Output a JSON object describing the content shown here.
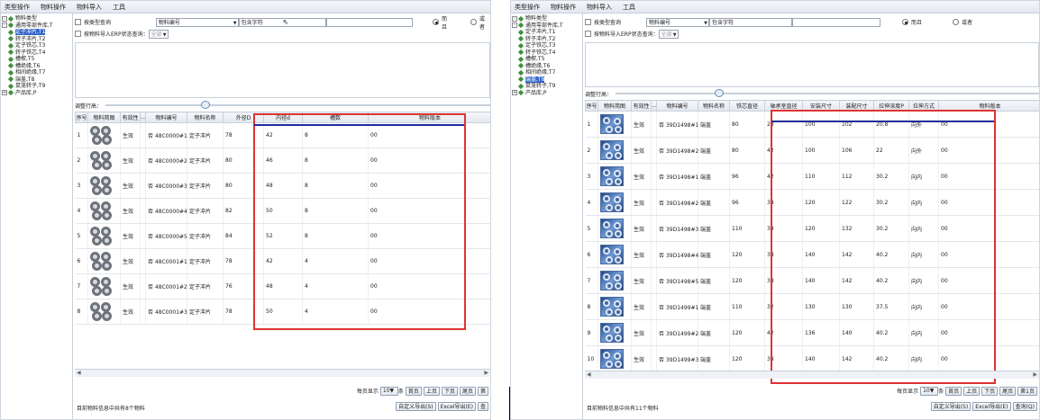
{
  "menu": [
    "类型操作",
    "物料操作",
    "物料导入",
    "工具"
  ],
  "tree_panel_a": [
    {
      "label": "物料类型",
      "level": 0,
      "expander": "-"
    },
    {
      "label": "通用零部件库,T",
      "level": 0,
      "expander": "-"
    },
    {
      "label": "定子冲片,T1",
      "level": 1,
      "selected": true
    },
    {
      "label": "转子冲片,T2",
      "level": 1
    },
    {
      "label": "定子铁芯,T3",
      "level": 1
    },
    {
      "label": "转子铁芯,T4",
      "level": 1
    },
    {
      "label": "槽楔,T5",
      "level": 1
    },
    {
      "label": "槽绝缘,T6",
      "level": 1
    },
    {
      "label": "相间绝缘,T7",
      "level": 1
    },
    {
      "label": "端盖,T8",
      "level": 1
    },
    {
      "label": "鼠笼转子,T9",
      "level": 1
    },
    {
      "label": "产品库,P",
      "level": 0,
      "expander": "+"
    }
  ],
  "tree_panel_b": [
    {
      "label": "物料类型",
      "level": 0,
      "expander": "-"
    },
    {
      "label": "通用零部件库,T",
      "level": 0,
      "expander": "-"
    },
    {
      "label": "定子冲片,T1",
      "level": 1
    },
    {
      "label": "转子冲片,T2",
      "level": 1
    },
    {
      "label": "定子铁芯,T3",
      "level": 1
    },
    {
      "label": "转子铁芯,T4",
      "level": 1
    },
    {
      "label": "槽楔,T5",
      "level": 1
    },
    {
      "label": "槽绝缘,T6",
      "level": 1
    },
    {
      "label": "相间绝缘,T7",
      "level": 1
    },
    {
      "label": "端盖,T8",
      "level": 1,
      "selected": true
    },
    {
      "label": "鼠笼转子,T9",
      "level": 1
    },
    {
      "label": "产品库,P",
      "level": 0,
      "expander": "+"
    }
  ],
  "filter": {
    "by_type_label": "按类型查询",
    "field": "物料编号",
    "op": "包含字符",
    "value": "",
    "and_label": "而且",
    "or_label": "或者",
    "erp_label": "按物料导入ERP状态查询：",
    "erp_value": "全部"
  },
  "adjust_label": "调整行高：",
  "panel_a": {
    "columns": [
      "序号",
      "物料简图",
      "有效性",
      "...",
      "物料编号",
      "物料名称",
      "外径D",
      "内径d",
      "槽数",
      "物料版本"
    ],
    "rows": [
      {
        "no": "1",
        "valid": "生效",
        "dots": "否",
        "code": "48C0000#1",
        "name": "定子冲片",
        "D": "78",
        "d": "42",
        "slots": "8",
        "ver": "00"
      },
      {
        "no": "2",
        "valid": "生效",
        "dots": "否",
        "code": "48C0000#2",
        "name": "定子冲片",
        "D": "80",
        "d": "46",
        "slots": "8",
        "ver": "00"
      },
      {
        "no": "3",
        "valid": "生效",
        "dots": "否",
        "code": "48C0000#3",
        "name": "定子冲片",
        "D": "80",
        "d": "48",
        "slots": "8",
        "ver": "00"
      },
      {
        "no": "4",
        "valid": "生效",
        "dots": "否",
        "code": "48C0000#4",
        "name": "定子冲片",
        "D": "82",
        "d": "50",
        "slots": "8",
        "ver": "00"
      },
      {
        "no": "5",
        "valid": "生效",
        "dots": "否",
        "code": "48C0000#5",
        "name": "定子冲片",
        "D": "84",
        "d": "52",
        "slots": "8",
        "ver": "00"
      },
      {
        "no": "6",
        "valid": "生效",
        "dots": "否",
        "code": "48C0001#1",
        "name": "定子冲片",
        "D": "78",
        "d": "42",
        "slots": "4",
        "ver": "00"
      },
      {
        "no": "7",
        "valid": "生效",
        "dots": "否",
        "code": "48C0001#2",
        "name": "定子冲片",
        "D": "76",
        "d": "48",
        "slots": "4",
        "ver": "00"
      },
      {
        "no": "8",
        "valid": "生效",
        "dots": "否",
        "code": "48C0001#3",
        "name": "定子冲片",
        "D": "78",
        "d": "50",
        "slots": "4",
        "ver": "00"
      }
    ],
    "page_size_label": "每页显示",
    "page_size": "10",
    "page_size_unit": "条",
    "pager_buttons": [
      "首页",
      "上页",
      "下页",
      "尾页",
      "第"
    ],
    "status": "目前物料信息中共有8个物料",
    "export_buttons": [
      "自定义导出(S)",
      "Excel导出(E)",
      "查"
    ]
  },
  "panel_b": {
    "columns": [
      "序号",
      "物料简图",
      "有效性",
      "...",
      "物料编号",
      "物料名称",
      "铁芯直径",
      "轴承室直径",
      "安装尺寸",
      "装配尺寸",
      "拉伸深度P",
      "拉伸方式",
      "物料版本"
    ],
    "rows": [
      {
        "no": "1",
        "valid": "生效",
        "dots": "否",
        "code": "39D1498#1",
        "name": "端盖",
        "c1": "80",
        "c2": "28",
        "c3": "100",
        "c4": "102",
        "c5": "20.8",
        "c6": "向外",
        "ver": "00"
      },
      {
        "no": "2",
        "valid": "生效",
        "dots": "否",
        "code": "39D1498#2",
        "name": "端盖",
        "c1": "80",
        "c2": "42",
        "c3": "100",
        "c4": "106",
        "c5": "22",
        "c6": "向外",
        "ver": "00"
      },
      {
        "no": "3",
        "valid": "生效",
        "dots": "否",
        "code": "39D1498#1",
        "name": "端盖",
        "c1": "96",
        "c2": "42",
        "c3": "110",
        "c4": "112",
        "c5": "30.2",
        "c6": "向内",
        "ver": "00"
      },
      {
        "no": "4",
        "valid": "生效",
        "dots": "否",
        "code": "39D1498#2",
        "name": "端盖",
        "c1": "96",
        "c2": "38",
        "c3": "120",
        "c4": "122",
        "c5": "30.2",
        "c6": "向内",
        "ver": "00"
      },
      {
        "no": "5",
        "valid": "生效",
        "dots": "否",
        "code": "39D1498#3",
        "name": "端盖",
        "c1": "110",
        "c2": "38",
        "c3": "120",
        "c4": "132",
        "c5": "30.2",
        "c6": "向内",
        "ver": "00"
      },
      {
        "no": "6",
        "valid": "生效",
        "dots": "否",
        "code": "39D1498#4",
        "name": "端盖",
        "c1": "120",
        "c2": "38",
        "c3": "140",
        "c4": "142",
        "c5": "40.2",
        "c6": "向内",
        "ver": "00"
      },
      {
        "no": "7",
        "valid": "生效",
        "dots": "否",
        "code": "39D1498#5",
        "name": "端盖",
        "c1": "120",
        "c2": "38",
        "c3": "140",
        "c4": "142",
        "c5": "40.2",
        "c6": "向内",
        "ver": "00"
      },
      {
        "no": "8",
        "valid": "生效",
        "dots": "否",
        "code": "39D1499#1",
        "name": "端盖",
        "c1": "110",
        "c2": "32",
        "c3": "130",
        "c4": "130",
        "c5": "37.5",
        "c6": "向内",
        "ver": "00"
      },
      {
        "no": "9",
        "valid": "生效",
        "dots": "否",
        "code": "39D1499#2",
        "name": "端盖",
        "c1": "120",
        "c2": "42",
        "c3": "136",
        "c4": "140",
        "c5": "40.2",
        "c6": "向内",
        "ver": "00"
      },
      {
        "no": "10",
        "valid": "生效",
        "dots": "否",
        "code": "39D1499#3",
        "name": "端盖",
        "c1": "120",
        "c2": "38",
        "c3": "140",
        "c4": "142",
        "c5": "40.2",
        "c6": "向内",
        "ver": "00"
      }
    ],
    "page_size_label": "每页显示",
    "page_size": "10",
    "page_size_unit": "条",
    "pager_buttons": [
      "首页",
      "上页",
      "下页",
      "尾页",
      "第1页"
    ],
    "status": "目前物料信息中共有11个物料",
    "export_buttons": [
      "自定义导出(S)",
      "Excel导出(E)",
      "查询(Q)"
    ]
  },
  "colors": {
    "highlight_box": "#e03232",
    "header_underline": "#1f2d9a",
    "tree_selected": "#3366cc"
  }
}
